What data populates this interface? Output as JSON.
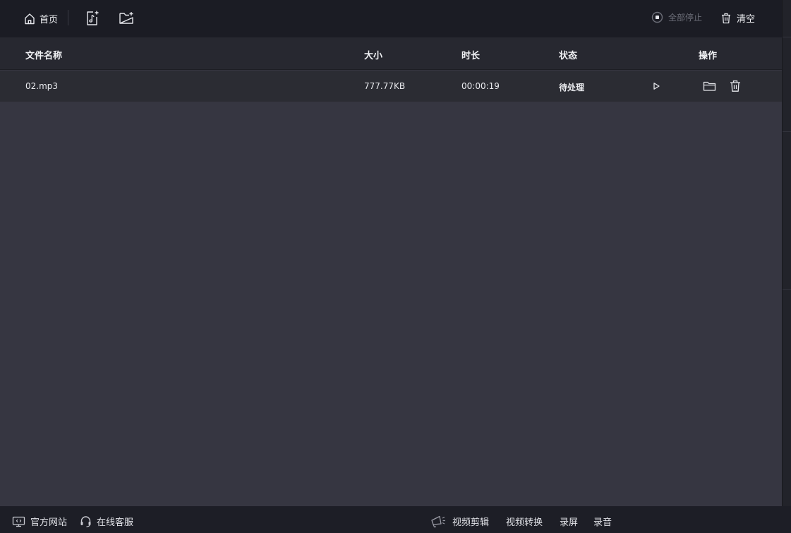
{
  "toolbar": {
    "home_label": "首页",
    "stop_all_label": "全部停止",
    "clear_label": "清空"
  },
  "table": {
    "headers": {
      "name": "文件名称",
      "size": "大小",
      "duration": "时长",
      "status": "状态",
      "actions": "操作"
    },
    "rows": [
      {
        "name": "02.mp3",
        "size": "777.77KB",
        "duration": "00:00:19",
        "status": "待处理"
      }
    ]
  },
  "footer": {
    "official_site": "官方网站",
    "online_service": "在线客服",
    "video_edit": "视频剪辑",
    "video_convert": "视频转换",
    "screen_record": "录屏",
    "audio_record": "录音"
  },
  "colors": {
    "toolbar_bg": "#1b1c24",
    "header_bg": "#272830",
    "row_bg": "#2b2c33",
    "content_bg": "#363641",
    "muted_text": "#6c6e78"
  },
  "icons": [
    "home-icon",
    "add-audio-icon",
    "add-folder-icon",
    "stop-circle-icon",
    "trash-icon",
    "play-icon",
    "folder-icon",
    "monitor-icon",
    "headset-icon",
    "megaphone-icon"
  ]
}
